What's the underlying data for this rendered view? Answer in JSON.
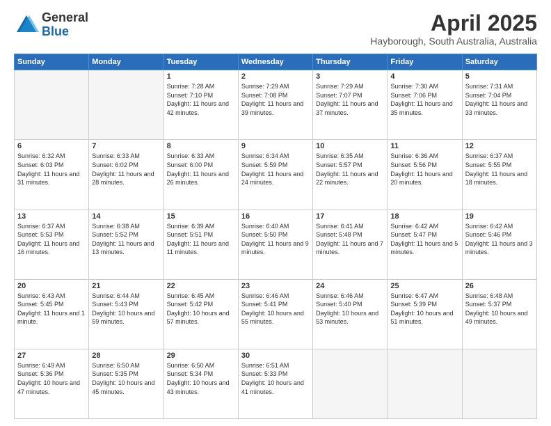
{
  "logo": {
    "general": "General",
    "blue": "Blue"
  },
  "title": "April 2025",
  "subtitle": "Hayborough, South Australia, Australia",
  "days_of_week": [
    "Sunday",
    "Monday",
    "Tuesday",
    "Wednesday",
    "Thursday",
    "Friday",
    "Saturday"
  ],
  "weeks": [
    [
      {
        "day": "",
        "info": "",
        "empty": true
      },
      {
        "day": "",
        "info": "",
        "empty": true
      },
      {
        "day": "1",
        "info": "Sunrise: 7:28 AM\nSunset: 7:10 PM\nDaylight: 11 hours and 42 minutes."
      },
      {
        "day": "2",
        "info": "Sunrise: 7:29 AM\nSunset: 7:08 PM\nDaylight: 11 hours and 39 minutes."
      },
      {
        "day": "3",
        "info": "Sunrise: 7:29 AM\nSunset: 7:07 PM\nDaylight: 11 hours and 37 minutes."
      },
      {
        "day": "4",
        "info": "Sunrise: 7:30 AM\nSunset: 7:06 PM\nDaylight: 11 hours and 35 minutes."
      },
      {
        "day": "5",
        "info": "Sunrise: 7:31 AM\nSunset: 7:04 PM\nDaylight: 11 hours and 33 minutes."
      }
    ],
    [
      {
        "day": "6",
        "info": "Sunrise: 6:32 AM\nSunset: 6:03 PM\nDaylight: 11 hours and 31 minutes."
      },
      {
        "day": "7",
        "info": "Sunrise: 6:33 AM\nSunset: 6:02 PM\nDaylight: 11 hours and 28 minutes."
      },
      {
        "day": "8",
        "info": "Sunrise: 6:33 AM\nSunset: 6:00 PM\nDaylight: 11 hours and 26 minutes."
      },
      {
        "day": "9",
        "info": "Sunrise: 6:34 AM\nSunset: 5:59 PM\nDaylight: 11 hours and 24 minutes."
      },
      {
        "day": "10",
        "info": "Sunrise: 6:35 AM\nSunset: 5:57 PM\nDaylight: 11 hours and 22 minutes."
      },
      {
        "day": "11",
        "info": "Sunrise: 6:36 AM\nSunset: 5:56 PM\nDaylight: 11 hours and 20 minutes."
      },
      {
        "day": "12",
        "info": "Sunrise: 6:37 AM\nSunset: 5:55 PM\nDaylight: 11 hours and 18 minutes."
      }
    ],
    [
      {
        "day": "13",
        "info": "Sunrise: 6:37 AM\nSunset: 5:53 PM\nDaylight: 11 hours and 16 minutes."
      },
      {
        "day": "14",
        "info": "Sunrise: 6:38 AM\nSunset: 5:52 PM\nDaylight: 11 hours and 13 minutes."
      },
      {
        "day": "15",
        "info": "Sunrise: 6:39 AM\nSunset: 5:51 PM\nDaylight: 11 hours and 11 minutes."
      },
      {
        "day": "16",
        "info": "Sunrise: 6:40 AM\nSunset: 5:50 PM\nDaylight: 11 hours and 9 minutes."
      },
      {
        "day": "17",
        "info": "Sunrise: 6:41 AM\nSunset: 5:48 PM\nDaylight: 11 hours and 7 minutes."
      },
      {
        "day": "18",
        "info": "Sunrise: 6:42 AM\nSunset: 5:47 PM\nDaylight: 11 hours and 5 minutes."
      },
      {
        "day": "19",
        "info": "Sunrise: 6:42 AM\nSunset: 5:46 PM\nDaylight: 11 hours and 3 minutes."
      }
    ],
    [
      {
        "day": "20",
        "info": "Sunrise: 6:43 AM\nSunset: 5:45 PM\nDaylight: 11 hours and 1 minute."
      },
      {
        "day": "21",
        "info": "Sunrise: 6:44 AM\nSunset: 5:43 PM\nDaylight: 10 hours and 59 minutes."
      },
      {
        "day": "22",
        "info": "Sunrise: 6:45 AM\nSunset: 5:42 PM\nDaylight: 10 hours and 57 minutes."
      },
      {
        "day": "23",
        "info": "Sunrise: 6:46 AM\nSunset: 5:41 PM\nDaylight: 10 hours and 55 minutes."
      },
      {
        "day": "24",
        "info": "Sunrise: 6:46 AM\nSunset: 5:40 PM\nDaylight: 10 hours and 53 minutes."
      },
      {
        "day": "25",
        "info": "Sunrise: 6:47 AM\nSunset: 5:39 PM\nDaylight: 10 hours and 51 minutes."
      },
      {
        "day": "26",
        "info": "Sunrise: 6:48 AM\nSunset: 5:37 PM\nDaylight: 10 hours and 49 minutes."
      }
    ],
    [
      {
        "day": "27",
        "info": "Sunrise: 6:49 AM\nSunset: 5:36 PM\nDaylight: 10 hours and 47 minutes."
      },
      {
        "day": "28",
        "info": "Sunrise: 6:50 AM\nSunset: 5:35 PM\nDaylight: 10 hours and 45 minutes."
      },
      {
        "day": "29",
        "info": "Sunrise: 6:50 AM\nSunset: 5:34 PM\nDaylight: 10 hours and 43 minutes."
      },
      {
        "day": "30",
        "info": "Sunrise: 6:51 AM\nSunset: 5:33 PM\nDaylight: 10 hours and 41 minutes."
      },
      {
        "day": "",
        "info": "",
        "empty": true
      },
      {
        "day": "",
        "info": "",
        "empty": true
      },
      {
        "day": "",
        "info": "",
        "empty": true
      }
    ]
  ]
}
